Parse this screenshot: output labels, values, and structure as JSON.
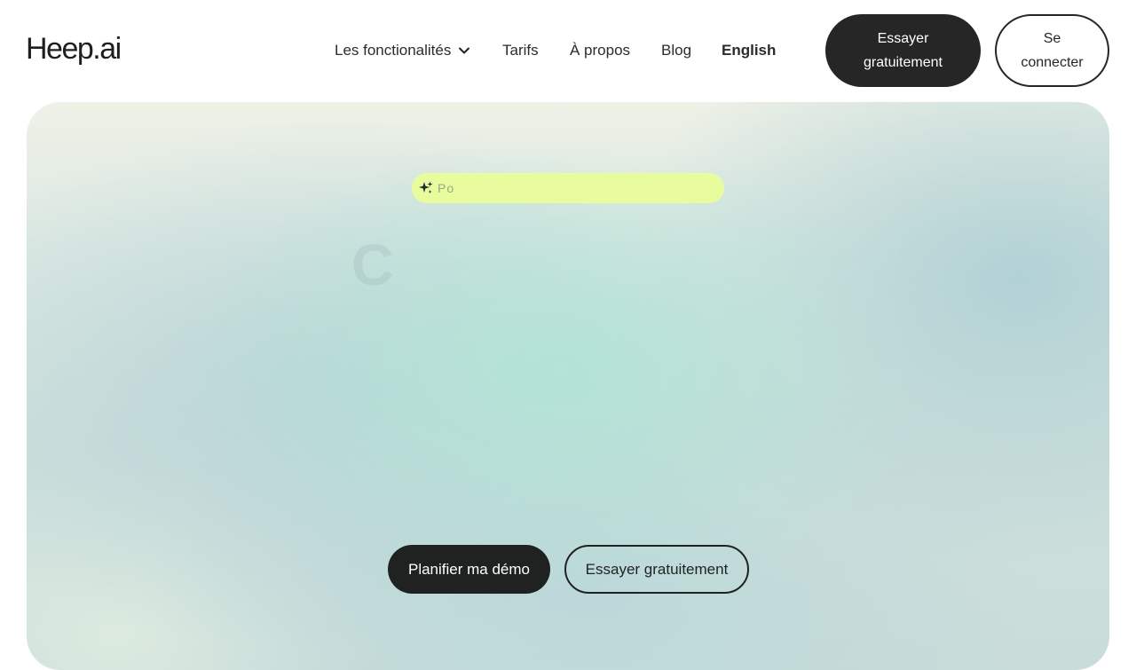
{
  "brand": {
    "logo_text": "Heep.ai"
  },
  "nav": {
    "items": [
      {
        "label": "Les fonctionalités",
        "has_dropdown": true
      },
      {
        "label": "Tarifs"
      },
      {
        "label": "À propos"
      },
      {
        "label": "Blog"
      },
      {
        "label": "English"
      }
    ]
  },
  "header_actions": {
    "try_label": "Essayer gratuitement",
    "login_label": "Se connecter"
  },
  "hero": {
    "badge_text": "Po",
    "badge_icon": "sparkles-icon",
    "heading_partial": "C",
    "primary_cta": "Planifier ma démo",
    "secondary_cta": "Essayer gratuitement"
  },
  "colors": {
    "dark": "#262626",
    "badge_bg": "#e8fc9e",
    "hero_mint": "#b2e4d6"
  }
}
